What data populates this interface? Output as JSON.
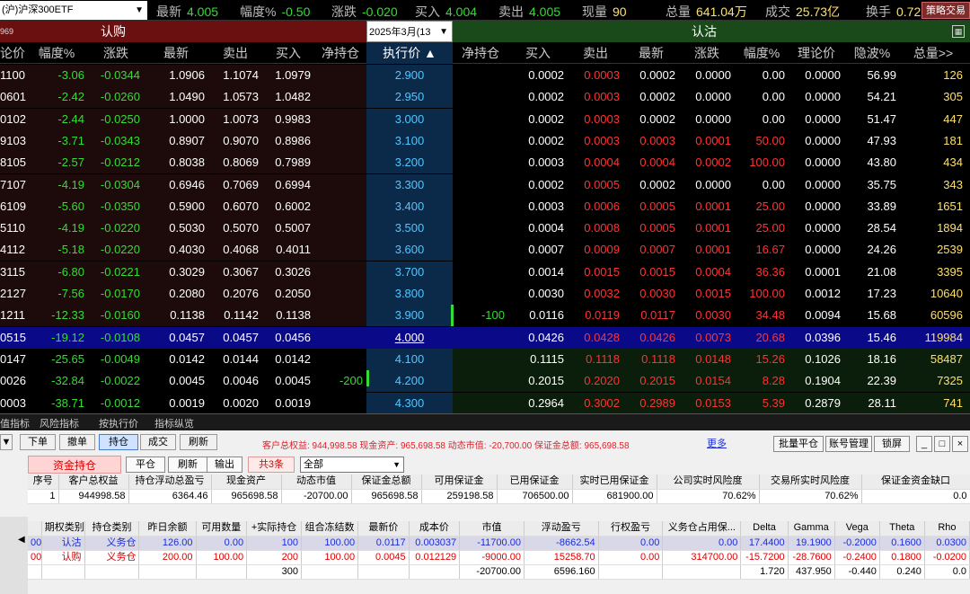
{
  "topbar": {
    "symbol": "(沪)沪深300ETF",
    "quotes": [
      {
        "label": "最新",
        "value": "4.005",
        "color": "#33dd33"
      },
      {
        "label": "幅度%",
        "value": "-0.50",
        "color": "#33dd33"
      },
      {
        "label": "涨跌",
        "value": "-0.020",
        "color": "#33dd33"
      },
      {
        "label": "买入",
        "value": "4.004",
        "color": "#33dd33"
      },
      {
        "label": "卖出",
        "value": "4.005",
        "color": "#33dd33"
      },
      {
        "label": "现量",
        "value": "90",
        "color": "#ffe066"
      },
      {
        "label": "总量",
        "value": "641.04万",
        "color": "#ffe066"
      },
      {
        "label": "成交",
        "value": "25.73亿",
        "color": "#ffe066"
      },
      {
        "label": "换手",
        "value": "0.72",
        "color": "#ffe066"
      }
    ],
    "strategy_button": "策略交易"
  },
  "groups": {
    "call_code": "969",
    "call_title": "认购",
    "month": "2025年3月(13",
    "put_title": "认沽"
  },
  "columns": {
    "call": [
      "论价",
      "幅度%",
      "涨跌",
      "最新",
      "卖出",
      "买入",
      "净持仓"
    ],
    "strike": "执行价 ▲",
    "put": [
      "净持仓",
      "买入",
      "卖出",
      "最新",
      "涨跌",
      "幅度%",
      "理论价",
      "隐波%",
      "总量>>"
    ]
  },
  "chain": [
    {
      "call": [
        "1100",
        "-3.06",
        "-0.0344",
        "1.0906",
        "1.1074",
        "1.0979",
        ""
      ],
      "strike": "2.900",
      "put": [
        "",
        "0.0002",
        "0.0003",
        "0.0002",
        "0.0000",
        "0.00",
        "0.0000",
        "56.99",
        "126"
      ]
    },
    {
      "call": [
        "0601",
        "-2.42",
        "-0.0260",
        "1.0490",
        "1.0573",
        "1.0482",
        ""
      ],
      "strike": "2.950",
      "put": [
        "",
        "0.0002",
        "0.0003",
        "0.0002",
        "0.0000",
        "0.00",
        "0.0000",
        "54.21",
        "305"
      ]
    },
    {
      "call": [
        "0102",
        "-2.44",
        "-0.0250",
        "1.0000",
        "1.0073",
        "0.9983",
        ""
      ],
      "strike": "3.000",
      "put": [
        "",
        "0.0002",
        "0.0003",
        "0.0002",
        "0.0000",
        "0.00",
        "0.0000",
        "51.47",
        "447"
      ]
    },
    {
      "call": [
        "9103",
        "-3.71",
        "-0.0343",
        "0.8907",
        "0.9070",
        "0.8986",
        ""
      ],
      "strike": "3.100",
      "put": [
        "",
        "0.0002",
        "0.0003",
        "0.0003",
        "0.0001",
        "50.00",
        "0.0000",
        "47.93",
        "181"
      ]
    },
    {
      "call": [
        "8105",
        "-2.57",
        "-0.0212",
        "0.8038",
        "0.8069",
        "0.7989",
        ""
      ],
      "strike": "3.200",
      "put": [
        "",
        "0.0003",
        "0.0004",
        "0.0004",
        "0.0002",
        "100.00",
        "0.0000",
        "43.80",
        "434"
      ]
    },
    {
      "call": [
        "7107",
        "-4.19",
        "-0.0304",
        "0.6946",
        "0.7069",
        "0.6994",
        ""
      ],
      "strike": "3.300",
      "put": [
        "",
        "0.0002",
        "0.0005",
        "0.0002",
        "0.0000",
        "0.00",
        "0.0000",
        "35.75",
        "343"
      ]
    },
    {
      "call": [
        "6109",
        "-5.60",
        "-0.0350",
        "0.5900",
        "0.6070",
        "0.6002",
        ""
      ],
      "strike": "3.400",
      "put": [
        "",
        "0.0003",
        "0.0006",
        "0.0005",
        "0.0001",
        "25.00",
        "0.0000",
        "33.89",
        "1651"
      ]
    },
    {
      "call": [
        "5110",
        "-4.19",
        "-0.0220",
        "0.5030",
        "0.5070",
        "0.5007",
        ""
      ],
      "strike": "3.500",
      "put": [
        "",
        "0.0004",
        "0.0008",
        "0.0005",
        "0.0001",
        "25.00",
        "0.0000",
        "28.54",
        "1894"
      ]
    },
    {
      "call": [
        "4112",
        "-5.18",
        "-0.0220",
        "0.4030",
        "0.4068",
        "0.4011",
        ""
      ],
      "strike": "3.600",
      "put": [
        "",
        "0.0007",
        "0.0009",
        "0.0007",
        "0.0001",
        "16.67",
        "0.0000",
        "24.26",
        "2539"
      ]
    },
    {
      "call": [
        "3115",
        "-6.80",
        "-0.0221",
        "0.3029",
        "0.3067",
        "0.3026",
        ""
      ],
      "strike": "3.700",
      "put": [
        "",
        "0.0014",
        "0.0015",
        "0.0015",
        "0.0004",
        "36.36",
        "0.0001",
        "21.08",
        "3395"
      ]
    },
    {
      "call": [
        "2127",
        "-7.56",
        "-0.0170",
        "0.2080",
        "0.2076",
        "0.2050",
        ""
      ],
      "strike": "3.800",
      "put": [
        "",
        "0.0030",
        "0.0032",
        "0.0030",
        "0.0015",
        "100.00",
        "0.0012",
        "17.23",
        "10640"
      ]
    },
    {
      "call": [
        "1211",
        "-12.33",
        "-0.0160",
        "0.1138",
        "0.1142",
        "0.1138",
        ""
      ],
      "strike": "3.900",
      "put": [
        "-100",
        "0.0116",
        "0.0119",
        "0.0117",
        "0.0030",
        "34.48",
        "0.0094",
        "15.68",
        "60596"
      ]
    },
    {
      "call": [
        "0515",
        "-19.12",
        "-0.0108",
        "0.0457",
        "0.0457",
        "0.0456",
        ""
      ],
      "strike": "4.000",
      "put": [
        "",
        "0.0426",
        "0.0428",
        "0.0426",
        "0.0073",
        "20.68",
        "0.0396",
        "15.46",
        "119984"
      ]
    },
    {
      "call": [
        "0147",
        "-25.65",
        "-0.0049",
        "0.0142",
        "0.0144",
        "0.0142",
        ""
      ],
      "strike": "4.100",
      "put": [
        "",
        "0.1115",
        "0.1118",
        "0.1118",
        "0.0148",
        "15.26",
        "0.1026",
        "18.16",
        "58487"
      ]
    },
    {
      "call": [
        "0026",
        "-32.84",
        "-0.0022",
        "0.0045",
        "0.0046",
        "0.0045",
        "-200"
      ],
      "strike": "4.200",
      "put": [
        "",
        "0.2015",
        "0.2020",
        "0.2015",
        "0.0154",
        "8.28",
        "0.1904",
        "22.39",
        "7325"
      ]
    },
    {
      "call": [
        "0003",
        "-38.71",
        "-0.0012",
        "0.0019",
        "0.0020",
        "0.0019",
        ""
      ],
      "strike": "4.300",
      "put": [
        "",
        "0.2964",
        "0.3002",
        "0.2989",
        "0.0153",
        "5.39",
        "0.2879",
        "28.11",
        "741"
      ]
    }
  ],
  "bottom_tabs": [
    "值指标",
    "风险指标",
    "按执行价",
    "指标纵览"
  ],
  "toolbar": {
    "buttons": [
      "下单",
      "撤单",
      "持仓",
      "成交",
      "刷新"
    ],
    "summary": "客户总权益: 944,998.58 现金资产: 965,698.58 动态市值: -20,700.00 保证金总额: 965,698.58",
    "more": "更多",
    "right_buttons": [
      "批量平仓",
      "账号管理",
      "锁屏"
    ],
    "window_buttons": [
      "_",
      "□",
      "×"
    ]
  },
  "subbar": {
    "fund_tab": "资金持仓",
    "buttons": [
      "平仓",
      "刷新",
      "输出"
    ],
    "count": "共3条",
    "filter": "全部"
  },
  "account_table": {
    "headers": [
      "序号",
      "客户总权益",
      "持仓浮动总盈亏",
      "现金资产",
      "动态市值",
      "保证金总额",
      "可用保证金",
      "已用保证金",
      "实时已用保证金",
      "公司实时风险度",
      "交易所实时风险度",
      "保证金资金缺口"
    ],
    "rows": [
      [
        "1",
        "944998.58",
        "6364.46",
        "965698.58",
        "-20700.00",
        "965698.58",
        "259198.58",
        "706500.00",
        "681900.00",
        "70.62%",
        "70.62%",
        "0.0"
      ]
    ]
  },
  "positions_table": {
    "headers": [
      "期权类别",
      "持仓类别",
      "昨日余额",
      "可用数量",
      "+实际持仓",
      "组合冻结数",
      "最新价",
      "成本价",
      "市值",
      "浮动盈亏",
      "行权盈亏",
      "义务仓占用保...",
      "Delta",
      "Gamma",
      "Vega",
      "Theta",
      "Rho"
    ],
    "rows": [
      [
        "00",
        "认沽",
        "义务仓",
        "126.00",
        "0.00",
        "100",
        "100.00",
        "0.0117",
        "0.003037",
        "-11700.00",
        "-8662.54",
        "0.00",
        "0.00",
        "17.4400",
        "19.1900",
        "-0.2000",
        "0.1600",
        "0.0300"
      ],
      [
        "00",
        "认购",
        "义务仓",
        "200.00",
        "100.00",
        "200",
        "100.00",
        "0.0045",
        "0.012129",
        "-9000.00",
        "15258.70",
        "0.00",
        "314700.00",
        "-15.7200",
        "-28.7600",
        "-0.2400",
        "0.1800",
        "-0.0200"
      ],
      [
        "",
        "",
        "",
        "",
        "",
        "300",
        "",
        "",
        "",
        "-20700.00",
        "6596.160",
        "",
        "",
        "1.720",
        "437.950",
        "-0.440",
        "0.240",
        "0.0"
      ]
    ]
  },
  "colors": {
    "call_header": "#6a1010",
    "put_header": "#1a4a1a",
    "strike_bg": "#0b2a4a",
    "atm_highlight": "#0a0a88",
    "up": "#ff3333",
    "down": "#33dd33"
  }
}
